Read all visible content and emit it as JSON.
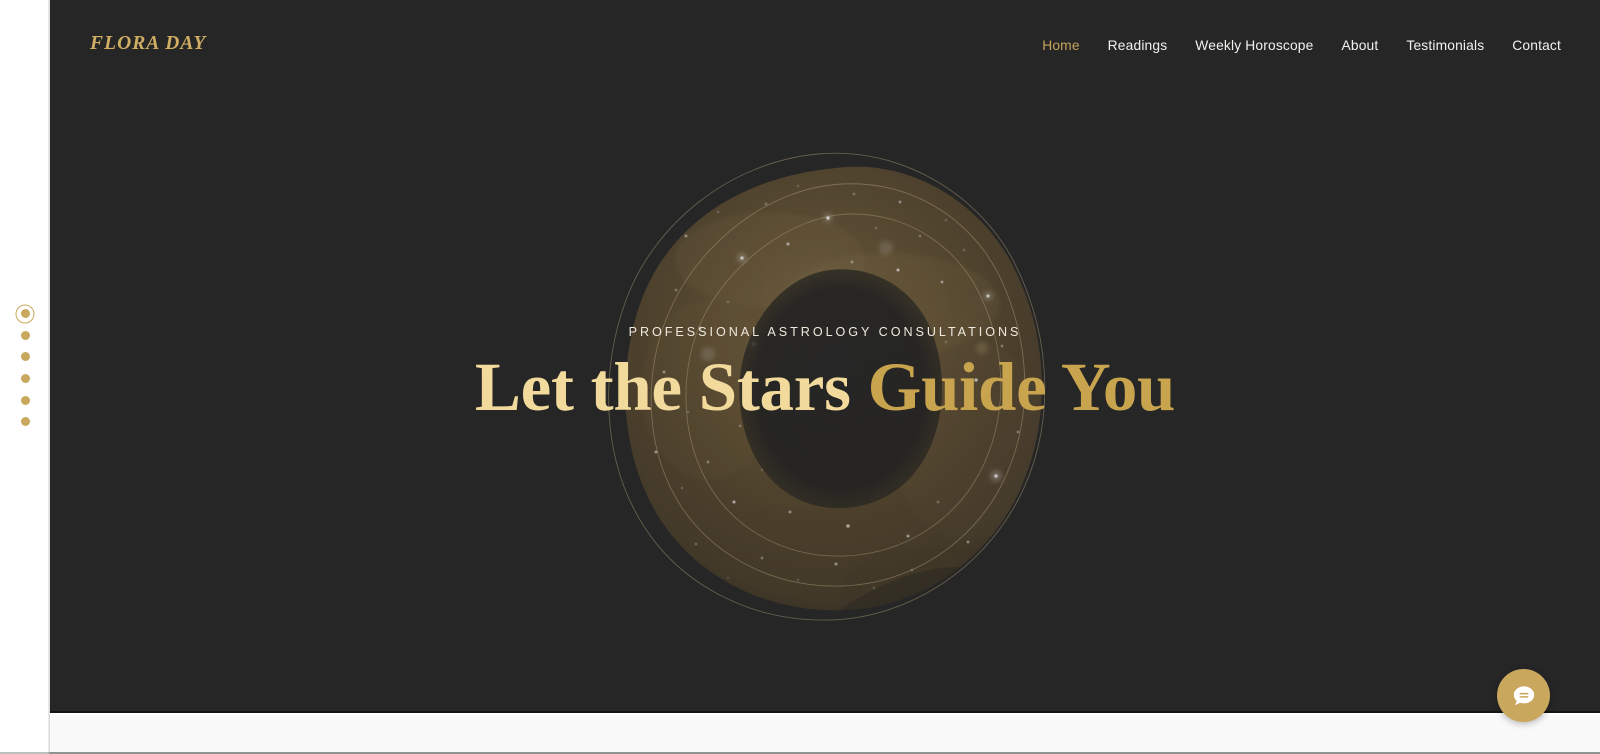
{
  "site": {
    "logo_text": "FLORA DAY",
    "accent_gold": "#c8a85c",
    "headline_light_gold": "#f2d99c",
    "headline_deep_gold": "#c9a44e",
    "hero_background": "#262626",
    "below_section_background": "#f9f9f9",
    "gutter_background": "#ffffff"
  },
  "nav": {
    "items": [
      {
        "label": "Home",
        "active": true
      },
      {
        "label": "Readings",
        "active": false
      },
      {
        "label": "Weekly Horoscope",
        "active": false
      },
      {
        "label": "About",
        "active": false
      },
      {
        "label": "Testimonials",
        "active": false
      },
      {
        "label": "Contact",
        "active": false
      }
    ]
  },
  "page_dots": {
    "count": 6,
    "active_index": 0,
    "items": [
      {
        "active": true
      },
      {
        "active": false
      },
      {
        "active": false
      },
      {
        "active": false
      },
      {
        "active": false
      },
      {
        "active": false
      }
    ]
  },
  "hero": {
    "eyebrow": "PROFESSIONAL ASTROLOGY CONSULTATIONS",
    "headline_part_a": "Let the Stars ",
    "headline_part_b": "Guide You",
    "artwork_name": "celestial-starfield-blob"
  },
  "chat_widget": {
    "icon": "chat-bubble-icon",
    "background": "#c9a85e"
  }
}
